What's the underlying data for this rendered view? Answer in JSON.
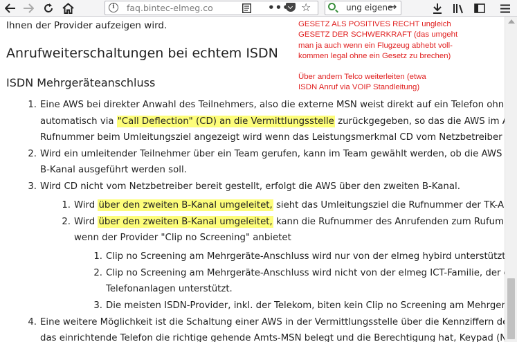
{
  "browser": {
    "url": "faq.bintec-elmeg.com/",
    "search_text": "ung eigene"
  },
  "article": {
    "intro_line": "Ihnen der Provider aufzeigen wird.",
    "heading": "Anrufweiterschaltungen bei echtem ISDN",
    "subheading": "ISDN Mehrgeräteanschluss",
    "items": [
      {
        "num": "1.",
        "l1": "Eine AWS bei direkter Anwahl des Teilnehmers, also die externe MSN weist direkt auf ein Telefon ohne Team oder",
        "l2_pre": "automatisch via ",
        "l2_hl": "\"Call Deflection\" (CD) an die Vermittlungsstelle",
        "l2_post": " zurückgegeben, so das die AWS im Amt erfolgt. In",
        "l3": "Rufnummer beim Umleitungsziel angezeigt wird wenn das Leistungsmerkmal CD vom Netzbetreiber bereit gestellt"
      },
      {
        "num": "2.",
        "l1": "Wird ein umleitender Teilnehmer über ein Team gerufen, kann im Team gewählt werden, ob die AWS im Amt (CD",
        "l2": "B-Kanal ausgeführt werden soll."
      },
      {
        "num": "3.",
        "l1": "Wird CD nicht vom Netzbetreiber bereit gestellt, erfolgt die AWS über den zweiten B-Kanal.",
        "sub": [
          {
            "num": "1.",
            "pre": "Wird ",
            "hl": "über den zweiten B-Kanal umgeleitet,",
            "post": " sieht das Umleitungsziel die Rufnummer der TK-Anlage"
          },
          {
            "num": "2.",
            "pre": "Wird ",
            "hl": "über den zweiten B-Kanal umgeleitet,",
            "post": " kann die Rufnummer des Anrufenden zum Rufumleitungsziel",
            "l2": "wenn der Provider \"Clip no Screening\" anbietet",
            "sub": [
              {
                "num": "1.",
                "text": "Clip no Screening am Mehrgeräte-Anschluss wird nur von der elmeg hybird unterstützt."
              },
              {
                "num": "2.",
                "text": "Clip no Screening am Mehrgeräte-Anschluss wird nicht von der elmeg ICT-Familie, der elmeg T-",
                "l2": "Telefonanlagen unterstützt."
              },
              {
                "num": "3.",
                "text": "Die meisten ISDN-Provider, inkl. der Telekom, biten kein Clip no Screening am Mehrgeräte-Anschl"
              }
            ]
          }
        ]
      },
      {
        "num": "4.",
        "l1": "Eine weitere Möglichkeit ist die Schaltung einer AWS in der Vermittlungsstelle über die Kennziffern des Providers.",
        "l2": "das einrichtende Telefon die richtige gehende Amts-MSN belegt und die Berechtigung hat, Keypad (Netz-Direktbef"
      }
    ]
  },
  "annotation": {
    "color": "#e02020",
    "lines": [
      "GESETZ ALS POSITIVES RECHT ungleich",
      "GESETZ DER SCHWERKRAFT (das umgeht",
      "man ja auch wenn ein Flugzeug abhebt voll-",
      "kommen legal ohne ein Gesetz zu brechen)",
      "",
      "Über andern Telco weiterleiten (etwa",
      "ISDN Anruf via VOIP Standleitung)"
    ]
  },
  "colors": {
    "highlight": "#fdfd7a",
    "toolbar_bg": "#f4f4f5"
  }
}
